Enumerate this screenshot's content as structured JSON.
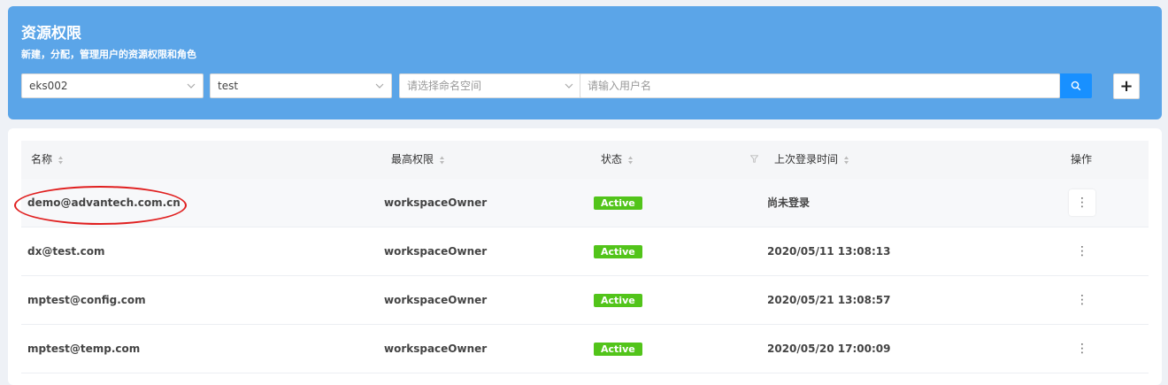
{
  "header": {
    "title": "资源权限",
    "subtitle": "新建，分配，管理用户的资源权限和角色"
  },
  "filters": {
    "cluster": "eks002",
    "workspace": "test",
    "namespace_placeholder": "请选择命名空间",
    "search_placeholder": "请输入用户名",
    "search_icon": "search-icon",
    "add_icon": "plus-icon",
    "add_label": "+"
  },
  "table": {
    "columns": {
      "name": "名称",
      "role": "最高权限",
      "status": "状态",
      "last_login": "上次登录时间",
      "actions": "操作"
    },
    "rows": [
      {
        "name": "demo@advantech.com.cn",
        "role": "workspaceOwner",
        "status": "Active",
        "last_login": "尚未登录"
      },
      {
        "name": "dx@test.com",
        "role": "workspaceOwner",
        "status": "Active",
        "last_login": "2020/05/11 13:08:13"
      },
      {
        "name": "mptest@config.com",
        "role": "workspaceOwner",
        "status": "Active",
        "last_login": "2020/05/21 13:08:57"
      },
      {
        "name": "mptest@temp.com",
        "role": "workspaceOwner",
        "status": "Active",
        "last_login": "2020/05/20 17:00:09"
      }
    ],
    "more_label": "⋮"
  },
  "colors": {
    "banner": "#5ba5e8",
    "primary": "#1890ff",
    "active": "#52c41a",
    "annotation": "#e02020"
  }
}
